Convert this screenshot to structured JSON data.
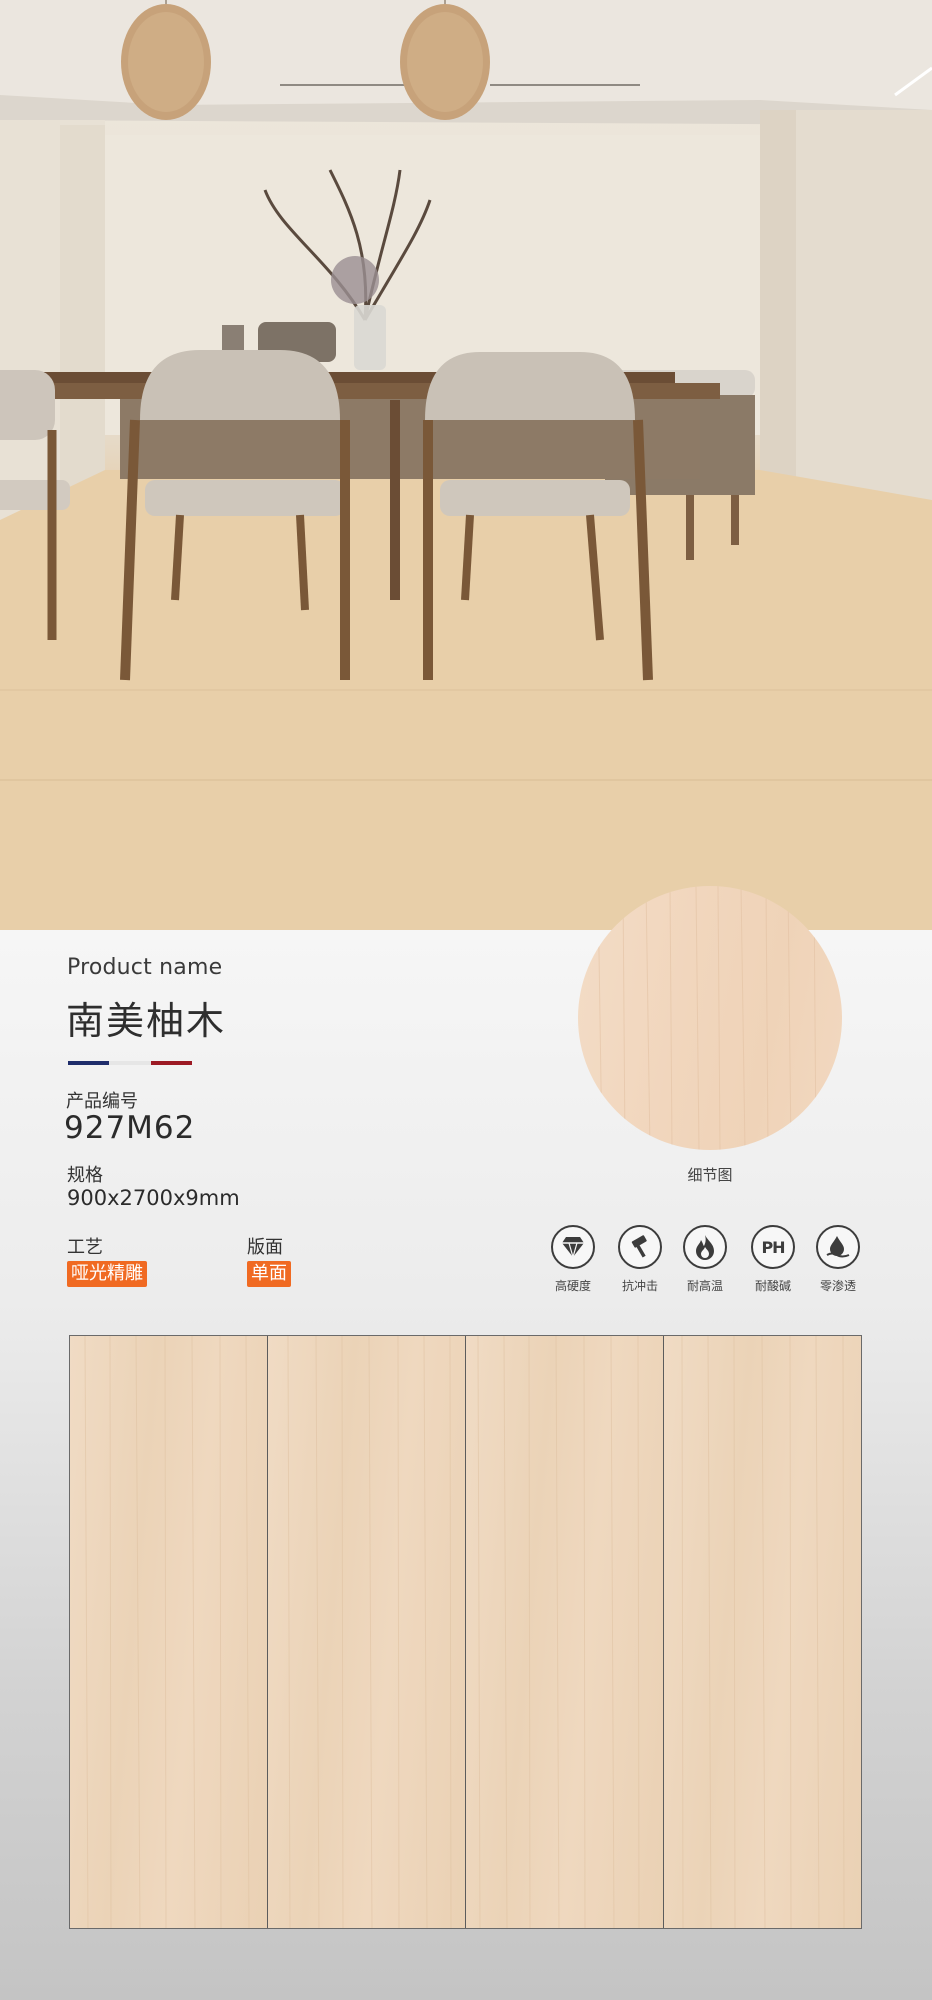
{
  "product": {
    "name_label": "Product name",
    "name": "南美柚木",
    "code_label": "产品编号",
    "code": "927M62",
    "spec_label": "规格",
    "spec": "900x2700x9mm",
    "craft_label": "工艺",
    "craft": "哑光精雕",
    "face_label": "版面",
    "face": "单面"
  },
  "detail": {
    "caption": "细节图"
  },
  "features": [
    {
      "icon": "diamond-icon",
      "label": "高硬度"
    },
    {
      "icon": "hammer-icon",
      "label": "抗冲击"
    },
    {
      "icon": "flame-icon",
      "label": "耐高温"
    },
    {
      "icon": "ph-icon",
      "label": "耐酸碱",
      "icon_text": "PH"
    },
    {
      "icon": "water-drop-icon",
      "label": "零渗透"
    }
  ],
  "colors": {
    "accent_tag": "#f06a22",
    "flag_blue": "#1f2d6b",
    "flag_red": "#9c1a24",
    "wood": "#ecd5bb"
  }
}
